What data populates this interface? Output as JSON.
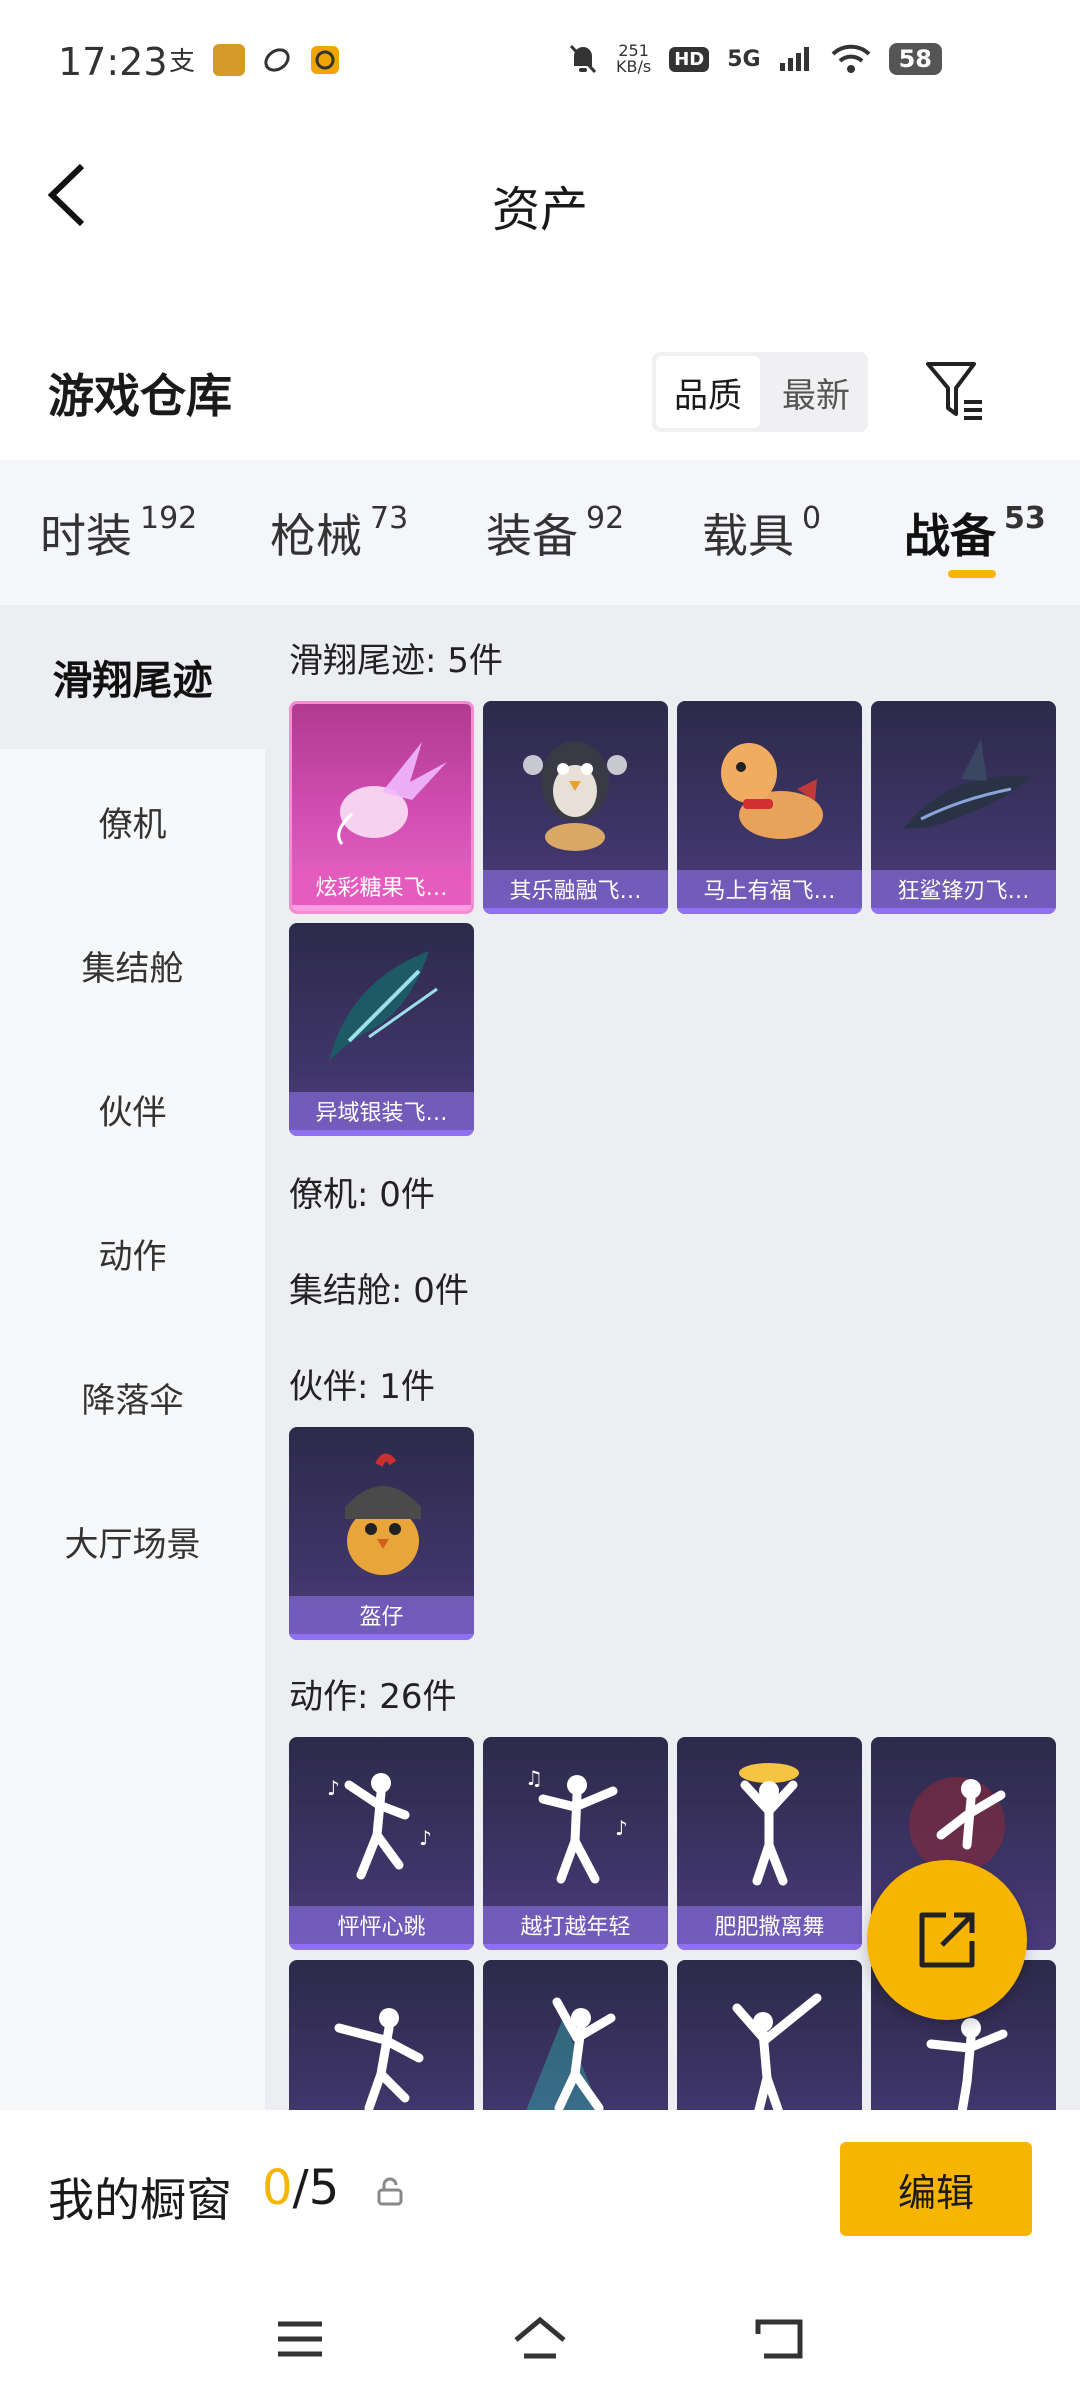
{
  "status_bar": {
    "time": "17:23",
    "speed_value": "251",
    "speed_unit": "KB/s",
    "hd": "HD",
    "network": "5G",
    "battery": "58"
  },
  "header": {
    "title": "资产"
  },
  "section": {
    "title": "游戏仓库",
    "sort_options": [
      "品质",
      "最新"
    ],
    "active_sort": "品质"
  },
  "tabs": [
    {
      "label": "时装",
      "count": "192"
    },
    {
      "label": "枪械",
      "count": "73"
    },
    {
      "label": "装备",
      "count": "92"
    },
    {
      "label": "载具",
      "count": "0"
    },
    {
      "label": "战备",
      "count": "53"
    }
  ],
  "active_tab": "战备",
  "sidebar": [
    {
      "label": "滑翔尾迹"
    },
    {
      "label": "僚机"
    },
    {
      "label": "集结舱"
    },
    {
      "label": "伙伴"
    },
    {
      "label": "动作"
    },
    {
      "label": "降落伞"
    },
    {
      "label": "大厅场景"
    }
  ],
  "groups": {
    "trails": {
      "title": "滑翔尾迹: 5件",
      "items": [
        "炫彩糖果飞…",
        "其乐融融飞…",
        "马上有福飞…",
        "狂鲨锋刃飞…",
        "异域银装飞…"
      ]
    },
    "wingman": {
      "title": "僚机: 0件"
    },
    "pod": {
      "title": "集结舱: 0件"
    },
    "partner": {
      "title": "伙伴: 1件",
      "items": [
        "盔仔"
      ]
    },
    "emotes": {
      "title": "动作: 26件",
      "items": [
        "怦怦心跳",
        "越打越年轻",
        "肥肥撒离舞"
      ]
    }
  },
  "showcase": {
    "label": "我的橱窗",
    "current": "0",
    "total": "/5",
    "edit_button": "编辑"
  },
  "colors": {
    "accent": "#f7b500",
    "card_purple": "#3d3466",
    "card_pink": "#d34fb4"
  }
}
